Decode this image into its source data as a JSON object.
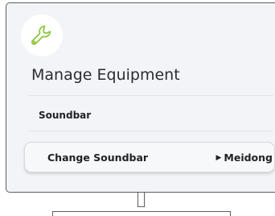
{
  "header": {
    "icon": "wrench-icon",
    "title": "Manage Equipment"
  },
  "section": {
    "label": "Soundbar"
  },
  "setting": {
    "label": "Change Soundbar",
    "value": "Meidong",
    "arrow": "▶"
  },
  "colors": {
    "accent": "#8dc63f",
    "screen_bg": "#f3f4f7",
    "frame": "#5a5d63"
  }
}
